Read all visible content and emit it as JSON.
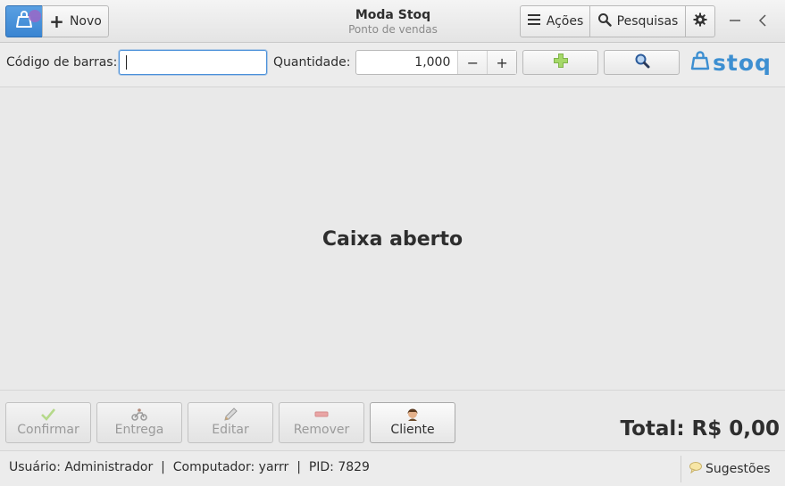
{
  "header": {
    "title": "Moda Stoq",
    "subtitle": "Ponto de vendas",
    "new_label": "Novo",
    "actions_label": "Ações",
    "searches_label": "Pesquisas"
  },
  "toolbar": {
    "barcode_label": "Código de barras:",
    "barcode_value": "",
    "quantity_label": "Quantidade:",
    "quantity_value": "1,000",
    "minus": "−",
    "plus": "+",
    "logo_text": "stoq"
  },
  "main": {
    "status_message": "Caixa aberto"
  },
  "actions": [
    {
      "label": "Confirmar",
      "icon": "checkmark-icon",
      "enabled": false
    },
    {
      "label": "Entrega",
      "icon": "motorcycle-icon",
      "enabled": false
    },
    {
      "label": "Editar",
      "icon": "pencil-icon",
      "enabled": false
    },
    {
      "label": "Remover",
      "icon": "remove-icon",
      "enabled": false
    },
    {
      "label": "Cliente",
      "icon": "client-icon",
      "enabled": true
    }
  ],
  "total": "Total: R$ 0,00",
  "statusbar": {
    "info": "Usuário: Administrador  |  Computador: yarrr  |  PID: 7829",
    "suggestions_label": "Sugestões"
  },
  "colors": {
    "accent": "#3a85d2",
    "logo": "#3d8fd1",
    "add_icon": "#9fd35a"
  }
}
